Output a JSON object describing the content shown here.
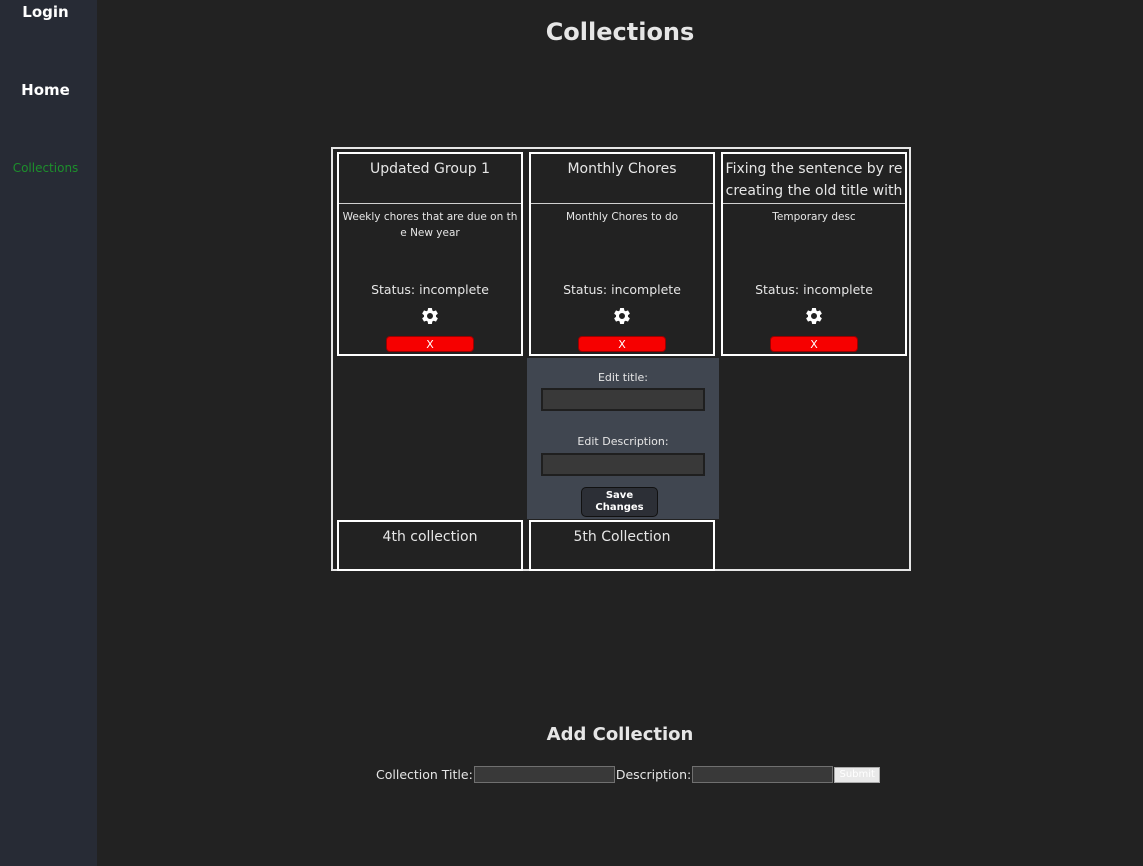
{
  "sidebar": {
    "items": [
      {
        "label": "Login"
      },
      {
        "label": "Home"
      },
      {
        "label": "Collections"
      }
    ]
  },
  "page": {
    "title": "Collections"
  },
  "collections": [
    {
      "title": "Updated Group 1",
      "description": "Weekly chores that are due on the New year",
      "status": "Status: incomplete",
      "delete_label": "X"
    },
    {
      "title": "Monthly Chores",
      "description": "Monthly Chores to do",
      "status": "Status: incomplete",
      "delete_label": "X"
    },
    {
      "title": "Fixing the sentence by recreating the old title with s",
      "description": "Temporary desc",
      "status": "Status: incomplete",
      "delete_label": "X"
    },
    {
      "title": "4th collection"
    },
    {
      "title": "5th Collection"
    }
  ],
  "edit_panel": {
    "title_label": "Edit title:",
    "title_value": "",
    "description_label": "Edit Description:",
    "description_value": "",
    "save_label": "Save Changes"
  },
  "add_collection": {
    "heading": "Add Collection",
    "title_label": "Collection Title:",
    "title_value": "",
    "description_label": "Description:",
    "description_value": "",
    "submit_label": "Submit"
  },
  "icons": {
    "settings": "gear-icon"
  },
  "colors": {
    "background": "#222222",
    "sidebar": "#272b35",
    "active_nav": "#1d8f2c",
    "delete": "#f60000",
    "edit_panel": "#404650"
  }
}
